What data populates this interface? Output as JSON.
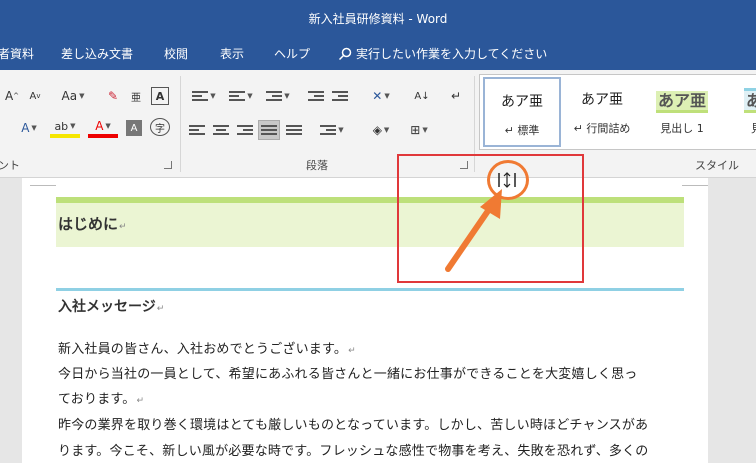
{
  "window": {
    "title": "新入社員研修資料 - Word"
  },
  "tabs": [
    {
      "label": "者資料"
    },
    {
      "label": "差し込み文書"
    },
    {
      "label": "校閲"
    },
    {
      "label": "表示"
    },
    {
      "label": "ヘルプ"
    }
  ],
  "search": {
    "label": "実行したい作業を入力してください"
  },
  "ribbon": {
    "font_group": {
      "label": "ント",
      "grow_font": "A",
      "shrink_font": "A",
      "change_case": "Aa",
      "text_effects": "A",
      "highlight": "ab",
      "font_color": "A",
      "char_shading": "A",
      "enclose_char": "字",
      "phonetic_guide": "亜",
      "char_border": "A"
    },
    "paragraph_group": {
      "label": "段落"
    },
    "styles_group": {
      "label": "スタイル",
      "styles": [
        {
          "sample": "あア亜",
          "name": "↵ 標準"
        },
        {
          "sample": "あア亜",
          "name": "↵ 行間詰め"
        },
        {
          "sample": "あア亜",
          "name": "見出し 1"
        },
        {
          "sample": "あア",
          "name": "見出"
        }
      ]
    }
  },
  "document": {
    "heading1": "はじめに",
    "heading2": "入社メッセージ",
    "paragraph_mark": "↵",
    "lines": [
      "新入社員の皆さん、入社おめでとうございます。",
      "今日から当社の一員として、希望にあふれる皆さんと一緒にお仕事ができることを大変嬉しく思っ",
      "ております。",
      "昨今の業界を取り巻く環境はとても厳しいものとなっています。しかし、苦しい時ほどチャンスがあ",
      "ります。今こそ、新しい風が必要な時です。フレッシュな感性で物事を考え、失敗を恐れず、多くの"
    ]
  },
  "colors": {
    "title_bar": "#2b579a",
    "heading1_band": "#ebf5d3",
    "heading1_rule": "#bde07a",
    "heading2_rule": "#8fd0e4",
    "annotation_box": "#e0383a",
    "annotation_arrow": "#f07a33"
  },
  "icons": [
    "search-icon",
    "resize-cursor-icon",
    "dialog-launcher-icon"
  ]
}
